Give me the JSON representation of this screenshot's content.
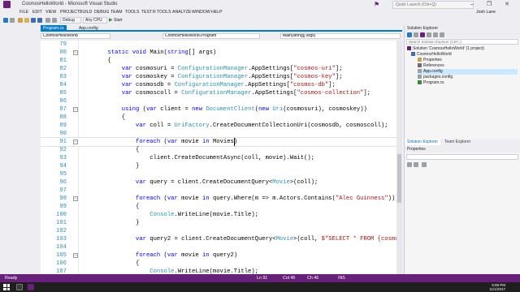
{
  "window": {
    "title": "CosmosHelloWorld - Microsoft Visual Studio",
    "quick_launch_placeholder": "Quick Launch (Ctrl+Q)",
    "window_buttons": "–  ❐  ✕",
    "user_name": "Josh Lane"
  },
  "menu": [
    "FILE",
    "EDIT",
    "VIEW",
    "PROJECT",
    "BUILD",
    "DEBUG",
    "TEAM",
    "TOOLS",
    "TEST",
    "R TOOLS",
    "ANALYZE",
    "WINDOW",
    "HELP"
  ],
  "toolbar": {
    "config": "Debug",
    "platform": "Any CPU",
    "start_label": "Start"
  },
  "tabs": [
    {
      "label": "Program.cs",
      "active": true
    },
    {
      "label": "App.config",
      "active": false
    }
  ],
  "navbar": {
    "project": "CosmosHelloWorld",
    "class": "CosmosHelloWorld.Program",
    "member": "Main(string[] args)"
  },
  "code": [
    {
      "n": "79",
      "t": ""
    },
    {
      "n": "80",
      "t": "        static void Main(string[] args)"
    },
    {
      "n": "81",
      "t": "        {"
    },
    {
      "n": "82",
      "t": "            var cosmosuri = ConfigurationManager.AppSettings[\"cosmos-uri\"];"
    },
    {
      "n": "83",
      "t": "            var cosmoskey = ConfigurationManager.AppSettings[\"cosmos-key\"];"
    },
    {
      "n": "84",
      "t": "            var cosmosdb = ConfigurationManager.AppSettings[\"cosmos-db\"];"
    },
    {
      "n": "85",
      "t": "            var cosmoscoll = ConfigurationManager.AppSettings[\"cosmos-collection\"];"
    },
    {
      "n": "86",
      "t": ""
    },
    {
      "n": "87",
      "t": "            using (var client = new DocumentClient(new Uri(cosmosuri), cosmoskey))"
    },
    {
      "n": "88",
      "t": "            {"
    },
    {
      "n": "89",
      "t": "                var coll = UriFactory.CreateDocumentCollectionUri(cosmosdb, cosmoscoll);"
    },
    {
      "n": "90",
      "t": ""
    },
    {
      "n": "91",
      "t": "                foreach (var movie in Movies)"
    },
    {
      "n": "92",
      "t": "                {"
    },
    {
      "n": "93",
      "t": "                    client.CreateDocumentAsync(coll, movie).Wait();"
    },
    {
      "n": "94",
      "t": "                }"
    },
    {
      "n": "95",
      "t": ""
    },
    {
      "n": "96",
      "t": "                var query = client.CreateDocumentQuery<Movie>(coll);"
    },
    {
      "n": "97",
      "t": ""
    },
    {
      "n": "98",
      "t": "                foreach (var movie in query.Where(m => m.Actors.Contains(\"Alec Guinness\")))"
    },
    {
      "n": "99",
      "t": "                {"
    },
    {
      "n": "100",
      "t": "                    Console.WriteLine(movie.Title);"
    },
    {
      "n": "101",
      "t": "                }"
    },
    {
      "n": "102",
      "t": ""
    },
    {
      "n": "103",
      "t": "                var query2 = client.CreateDocumentQuery<Movie>(coll, $\"SELECT * FROM {cosmosc"
    },
    {
      "n": "104",
      "t": ""
    },
    {
      "n": "105",
      "t": "                foreach (var movie in query2)"
    },
    {
      "n": "106",
      "t": "                {"
    },
    {
      "n": "107",
      "t": "                    Console.WriteLine(movie.Title);"
    }
  ],
  "solution_explorer": {
    "title": "Solution Explorer",
    "search_placeholder": "Search Solution Explorer (Ctrl+;)",
    "items": [
      {
        "label": "Solution 'CosmosHelloWorld' (1 project)",
        "indent": 0
      },
      {
        "label": "CosmosHelloWorld",
        "indent": 1
      },
      {
        "label": "Properties",
        "indent": 2
      },
      {
        "label": "References",
        "indent": 2
      },
      {
        "label": "App.config",
        "indent": 2,
        "selected": true
      },
      {
        "label": "packages.config",
        "indent": 2
      },
      {
        "label": "Program.cs",
        "indent": 2
      }
    ],
    "bottom_tabs": [
      "Solution Explorer",
      "Team Explorer"
    ]
  },
  "properties": {
    "title": "Properties"
  },
  "status": {
    "ready": "Ready",
    "ln": "Ln 91",
    "col": "Col 46",
    "ch": "Ch 46",
    "ins": "INS"
  },
  "taskbar": {
    "time": "9:09 PM",
    "date": "11/1/2017"
  },
  "colors": {
    "accent": "#007acc",
    "status_bar": "#68217a",
    "keyword": "#0000ff",
    "type": "#2b91af",
    "string": "#a31515"
  }
}
